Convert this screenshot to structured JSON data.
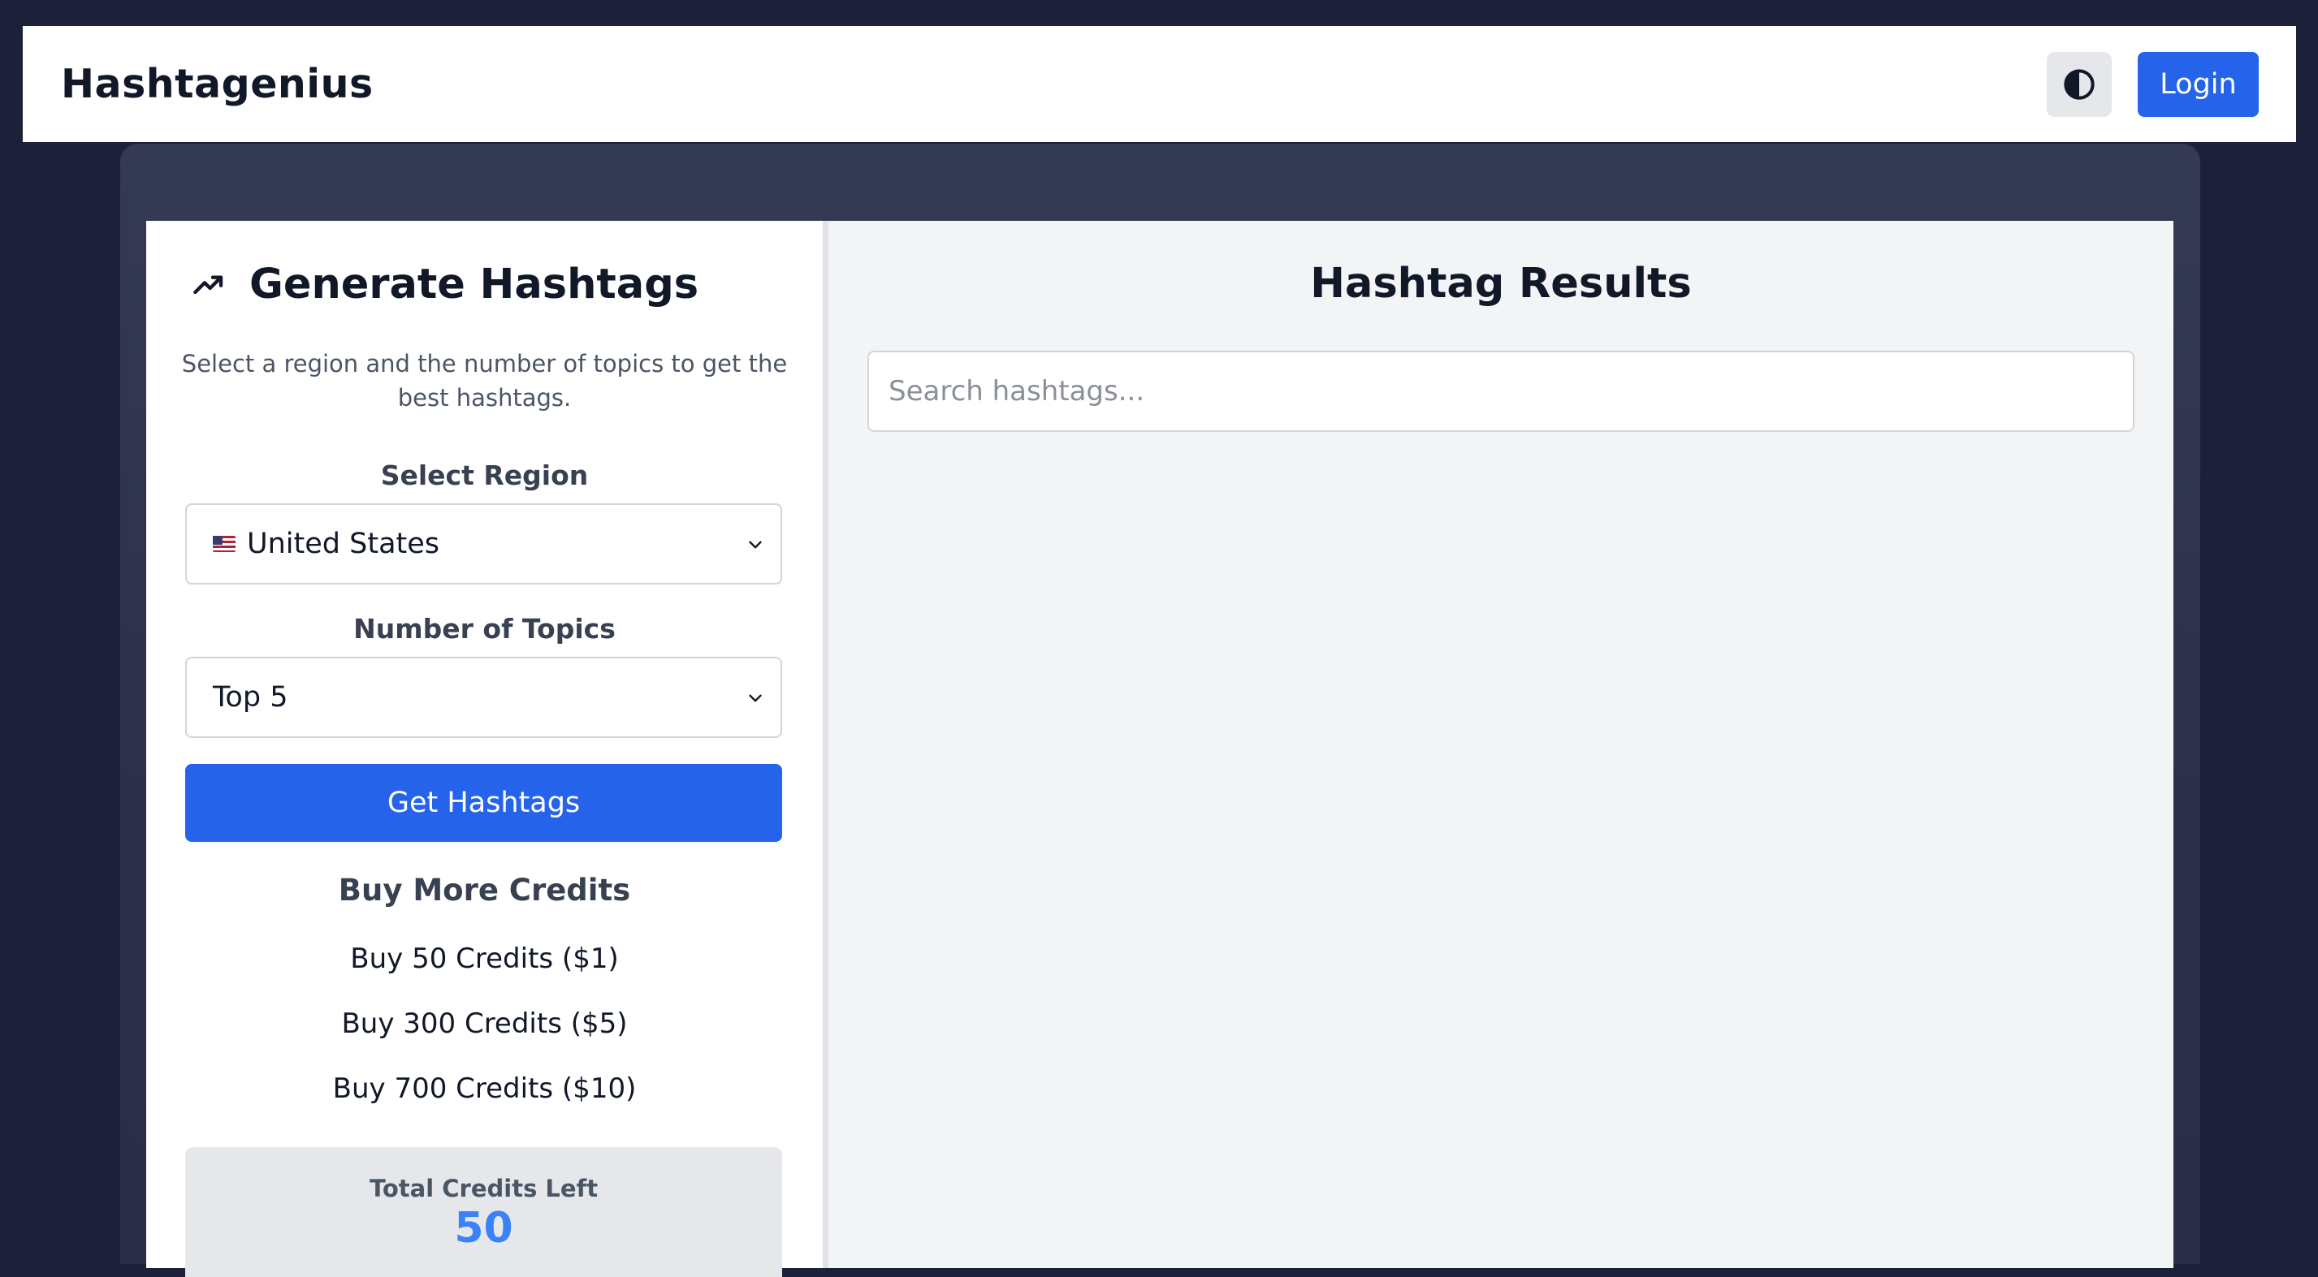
{
  "header": {
    "brand": "Hashtagenius",
    "theme_icon": "contrast-icon",
    "login_label": "Login"
  },
  "generator": {
    "icon": "trending-up-icon",
    "title": "Generate Hashtags",
    "subtitle": "Select a region and the number of topics to get the best hashtags.",
    "region_label": "Select Region",
    "region_value": "United States",
    "region_flag": "us-flag-icon",
    "topics_label": "Number of Topics",
    "topics_value": "Top 5",
    "submit_label": "Get Hashtags"
  },
  "credits": {
    "buy_title": "Buy More Credits",
    "options": [
      "Buy 50 Credits ($1)",
      "Buy 300 Credits ($5)",
      "Buy 700 Credits ($10)"
    ],
    "total_label": "Total Credits Left",
    "total_value": "50"
  },
  "results": {
    "title": "Hashtag Results",
    "search_placeholder": "Search hashtags..."
  },
  "colors": {
    "accent": "#2563eb",
    "background": "#1c2038",
    "credits_value": "#3b82f6"
  }
}
